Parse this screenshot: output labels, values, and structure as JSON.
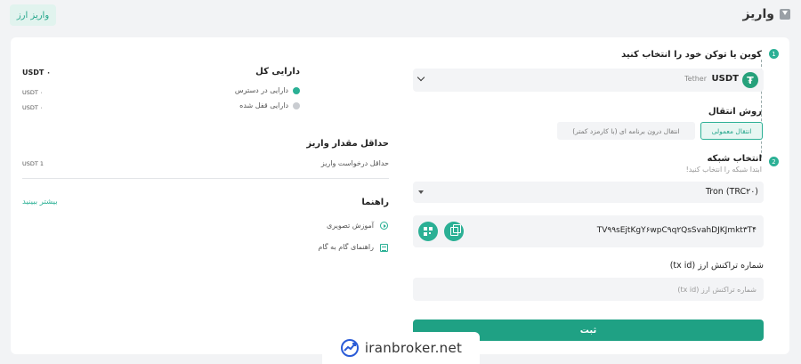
{
  "header": {
    "title": "واریز",
    "top_button": "واریز ارز"
  },
  "step1": {
    "number": "1",
    "title": "کوین یا توکن خود را انتخاب کنید",
    "coin_symbol": "USDT",
    "coin_name": "Tether",
    "coin_icon": "tether-icon"
  },
  "transfer": {
    "title": "روش انتقال",
    "normal_label": "انتقال معمولی",
    "internal_label": "انتقال درون برنامه ای (با کارمزد کمتر)"
  },
  "step2": {
    "number": "2",
    "title": "انتخاب شبکه",
    "subtitle": "ابتدا شبکه را انتخاب کنید!",
    "network_value": "Tron (TRC۲۰)"
  },
  "address": {
    "value": "TV۹۹sEjtKgY۶wpC۹q۲QsSvahDJKJmkt۳T۴"
  },
  "txid": {
    "label": "شماره تراکنش ارز (tx id)",
    "placeholder": "شماره تراکنش ارز (tx id)"
  },
  "submit_label": "ثبت",
  "balance": {
    "title": "دارایی کل",
    "total_value": "USDT ۰",
    "available_label": "دارایی در دسترس",
    "available_value": "USDT ۰",
    "locked_label": "دارایی قفل شده",
    "locked_value": "USDT ۰",
    "available_color": "#2bb095",
    "locked_color": "#c9ccd1"
  },
  "min_deposit": {
    "title": "حداقل مقدار واریز",
    "label": "حداقل درخواست واریز",
    "value": "USDT 1"
  },
  "guide": {
    "title": "راهنما",
    "more_link": "بیشتر ببینید",
    "video_label": "آموزش تصویری",
    "steps_label": "راهنمای گام به گام"
  },
  "watermark": {
    "text": "iranbroker.net"
  },
  "colors": {
    "accent": "#2bb095",
    "submit": "#1fa184"
  }
}
